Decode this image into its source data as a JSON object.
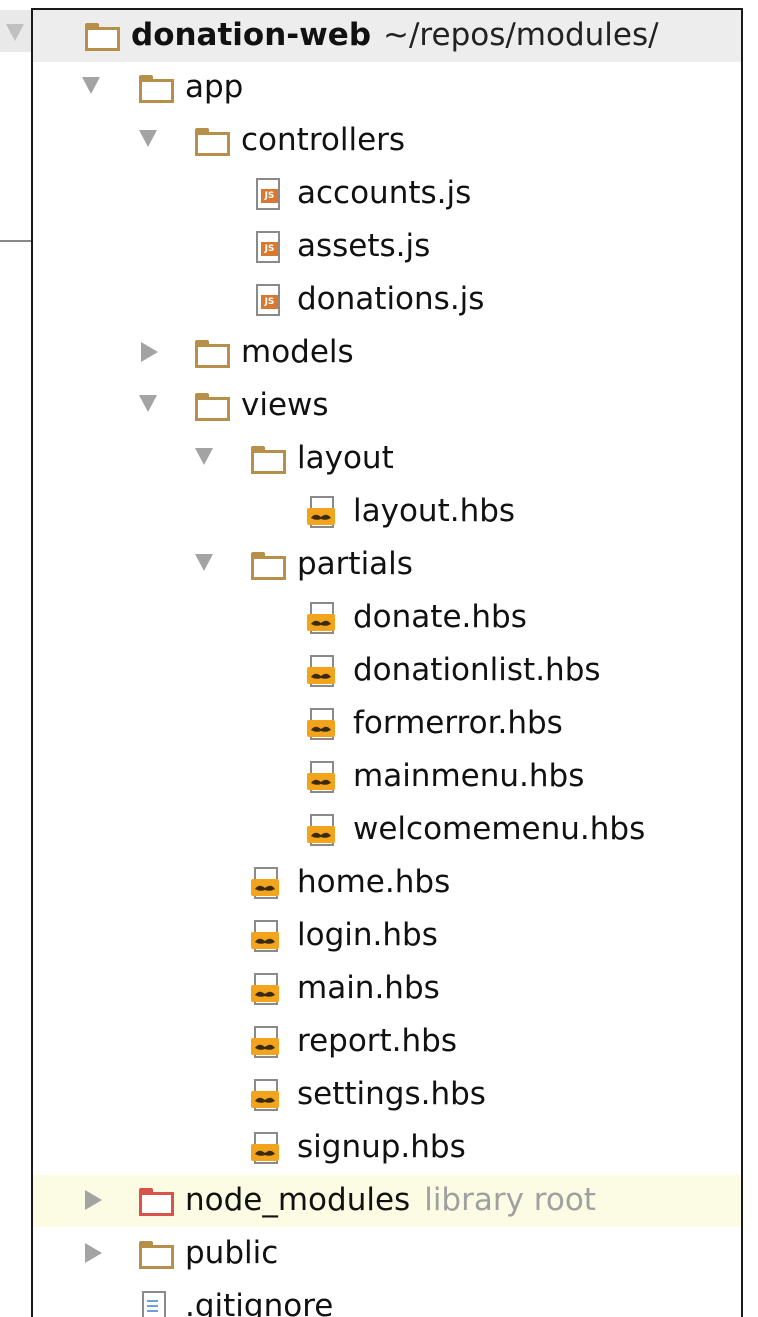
{
  "project_tree": {
    "root": {
      "name": "donation-web",
      "path": "~/repos/modules/"
    },
    "items": [
      {
        "label": "app",
        "type": "folder",
        "expanded": true
      },
      {
        "label": "controllers",
        "type": "folder",
        "expanded": true
      },
      {
        "label": "accounts.js",
        "type": "file-js"
      },
      {
        "label": "assets.js",
        "type": "file-js"
      },
      {
        "label": "donations.js",
        "type": "file-js"
      },
      {
        "label": "models",
        "type": "folder",
        "expanded": false
      },
      {
        "label": "views",
        "type": "folder",
        "expanded": true
      },
      {
        "label": "layout",
        "type": "folder",
        "expanded": true
      },
      {
        "label": "layout.hbs",
        "type": "file-hbs"
      },
      {
        "label": "partials",
        "type": "folder",
        "expanded": true
      },
      {
        "label": "donate.hbs",
        "type": "file-hbs"
      },
      {
        "label": "donationlist.hbs",
        "type": "file-hbs"
      },
      {
        "label": "formerror.hbs",
        "type": "file-hbs"
      },
      {
        "label": "mainmenu.hbs",
        "type": "file-hbs"
      },
      {
        "label": "welcomemenu.hbs",
        "type": "file-hbs"
      },
      {
        "label": "home.hbs",
        "type": "file-hbs"
      },
      {
        "label": "login.hbs",
        "type": "file-hbs"
      },
      {
        "label": "main.hbs",
        "type": "file-hbs"
      },
      {
        "label": "report.hbs",
        "type": "file-hbs"
      },
      {
        "label": "settings.hbs",
        "type": "file-hbs"
      },
      {
        "label": "signup.hbs",
        "type": "file-hbs"
      },
      {
        "label": "node_modules",
        "type": "folder",
        "expanded": false,
        "suffix": "library root",
        "icon_color": "#d9534a"
      },
      {
        "label": "public",
        "type": "folder",
        "expanded": false
      },
      {
        "label": ".gitignore",
        "type": "file-text"
      }
    ]
  },
  "colors": {
    "folder": "#b6904a",
    "library_folder": "#d9534a",
    "js_badge": "#d9792f",
    "hbs_badge": "#f2a41c",
    "library_row": "#fcfbe3"
  }
}
